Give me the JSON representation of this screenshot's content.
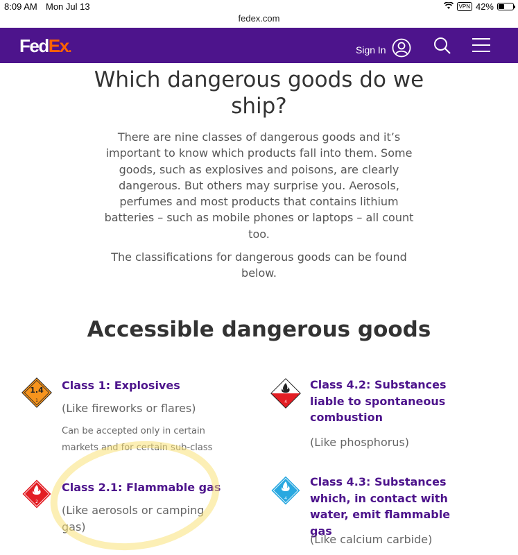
{
  "status_bar": {
    "time": "8:09 AM",
    "date": "Mon Jul 13",
    "vpn": "VPN",
    "battery": "42%",
    "battery_level": 0.42
  },
  "browser": {
    "url": "fedex.com"
  },
  "header": {
    "logo_fed": "Fed",
    "logo_ex": "Ex",
    "logo_dot": ".",
    "sign_in_label": "Sign In",
    "brand_color": "#4d148c",
    "accent_color": "#ff6200",
    "icons": [
      "user-circle-icon",
      "search-icon",
      "hamburger-menu-icon"
    ]
  },
  "main": {
    "title": "Which dangerous goods do we ship?",
    "intro": "There are nine classes of dangerous goods and it’s important to know which products fall into them. Some goods, such as explosives and poisons, are clearly dangerous. But others may surprise you. Aerosols, perfumes and most products that contains lithium batteries – such as mobile phones or laptops – all count too.",
    "intro2": "The classifications for dangerous goods can be found below.",
    "section_title": "Accessible dangerous goods",
    "classes": [
      {
        "title": "Class 1: Explosives",
        "example": "(Like fireworks or flares)",
        "note": "Can be accepted only in certain markets and for certain sub-class",
        "icon": "explosives-1-4-icon",
        "icon_text": "1.4",
        "color": "#f7941d"
      },
      {
        "title": "Class 4.2: Substances liable to spontaneous combustion",
        "example": "(Like phosphorus)",
        "icon": "spontaneous-combustion-icon",
        "color": "#e31e24"
      },
      {
        "title": "Class 2.1: Flammable gas",
        "example": "(Like aerosols or camping gas)",
        "icon": "flammable-gas-icon",
        "icon_text": "2",
        "color": "#e31e24"
      },
      {
        "title": "Class 4.3: Substances which, in contact with water, emit flammable gas",
        "example": "(Like calcium carbide)",
        "icon": "dangerous-when-wet-icon",
        "icon_text": "4",
        "color": "#29a8e0"
      }
    ]
  }
}
